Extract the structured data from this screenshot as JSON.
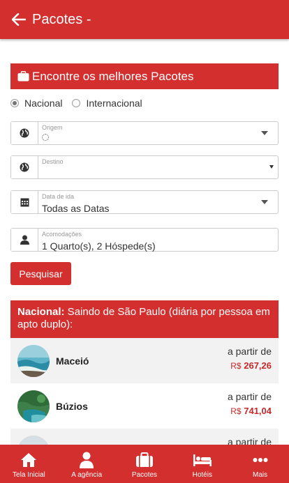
{
  "appbar": {
    "title": "Pacotes -"
  },
  "search": {
    "header": "Encontre os melhores Pacotes",
    "radios": [
      {
        "label": "Nacional",
        "checked": true
      },
      {
        "label": "Internacional",
        "checked": false
      }
    ],
    "origin": {
      "label": "Origem",
      "value": ""
    },
    "destination": {
      "label": "Destino",
      "value": ""
    },
    "date": {
      "label": "Data de ida",
      "value": "Todas as Datas"
    },
    "rooms": {
      "label": "Acomodações",
      "value": "1 Quarto(s), 2 Hóspede(s)"
    },
    "button": "Pesquisar"
  },
  "national": {
    "prefix": "Nacional:",
    "text": " Saindo de São Paulo (diária por pessoa em apto duplo):"
  },
  "packages": [
    {
      "name": "Maceió",
      "from": "a partir de",
      "currency": "R$",
      "price": "267,26"
    },
    {
      "name": "Búzios",
      "from": "a partir de",
      "currency": "R$",
      "price": "741,04"
    },
    {
      "name": "",
      "from": "a partir de",
      "currency": "",
      "price": ""
    }
  ],
  "bottom_nav": [
    {
      "label": "Tela Inicial",
      "icon": "home-icon"
    },
    {
      "label": "A agência",
      "icon": "person-icon"
    },
    {
      "label": "Pacotes",
      "icon": "suitcase-icon"
    },
    {
      "label": "Hotéis",
      "icon": "bed-icon"
    },
    {
      "label": "Mais",
      "icon": "more-dots-icon"
    }
  ],
  "colors": {
    "primary": "#d32f2f",
    "price": "#c62828",
    "row_alt": "#f2f2f2"
  }
}
